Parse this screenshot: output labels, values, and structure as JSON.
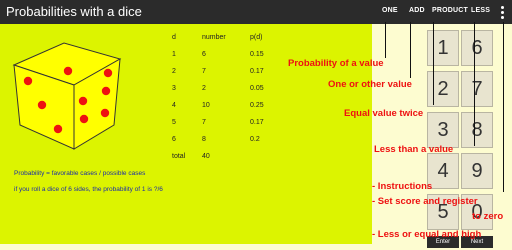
{
  "app": {
    "title": "Probabilities with a dice"
  },
  "tabs": [
    "ONE",
    "ADD",
    "PRODUCT",
    "LESS"
  ],
  "table": {
    "headers": [
      "d",
      "number",
      "p(d)"
    ],
    "rows": [
      [
        "1",
        "6",
        "0.15"
      ],
      [
        "2",
        "7",
        "0.17"
      ],
      [
        "3",
        "2",
        "0.05"
      ],
      [
        "4",
        "10",
        "0.25"
      ],
      [
        "5",
        "7",
        "0.17"
      ],
      [
        "6",
        "8",
        "0.2"
      ]
    ],
    "total_label": "total",
    "total_value": "40"
  },
  "info": {
    "formula": "Probability = favorable cases / possible cases",
    "question": "if you roll a dice of 6 sides, the probability of 1 is ?/6"
  },
  "keypad": {
    "keys": [
      "1",
      "6",
      "2",
      "7",
      "3",
      "8",
      "4",
      "9",
      "5",
      "0"
    ],
    "enter_label": "Enter",
    "next_label": "Next"
  },
  "annotations": [
    "Probability of a value",
    "One or other value",
    "Equal value twice",
    "Less than a value",
    "- Instructions",
    "- Set score and register",
    "to zero",
    "- Less or equal and high"
  ],
  "colors": {
    "topbar": "#2b2b2b",
    "panel": "#dcf400",
    "background": "#fdfcd0",
    "annotation": "#e11111",
    "info_text": "#1b2ca8"
  }
}
